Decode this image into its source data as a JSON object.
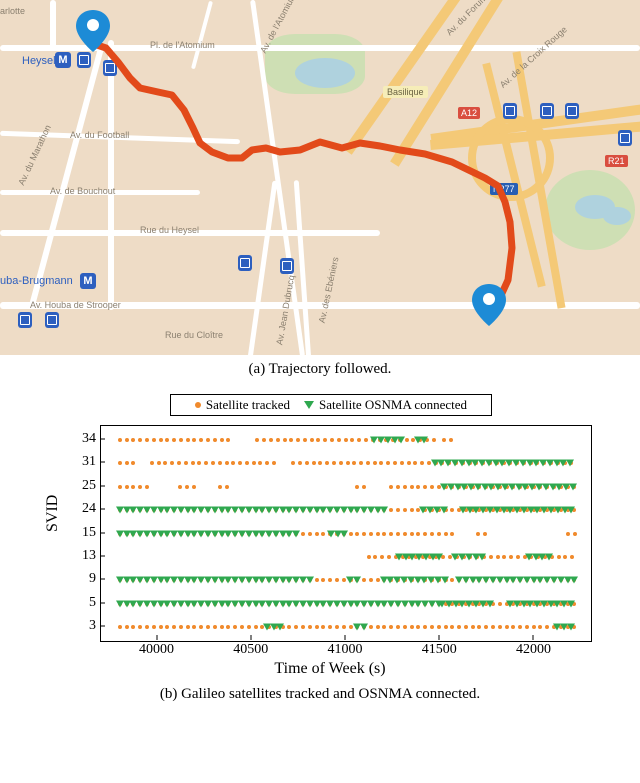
{
  "panel_a": {
    "caption": "(a) Trajectory followed.",
    "station_main": "Heysel",
    "station_secondary": "uba-Brugmann",
    "metro_letter": "M",
    "badge_basilique": "Basilique",
    "road_badge_a12": "A12",
    "road_badge_r21": "R21",
    "road_badge_n277_1": "N277",
    "road_badge_n277_2": "N277",
    "roads": {
      "arlotte": "arlotte",
      "atomium": "Pl. de l'Atomium",
      "av_atomium": "Av. de l'Atomium",
      "forum": "Av. du Forum",
      "croixrouge": "Av. de la Croix Rouge",
      "football": "Av. du Football",
      "bouchout": "Av. de Bouchout",
      "marathon": "Av. du Marathon",
      "heysel": "Rue du Heysel",
      "houba": "Av. Houba de Strooper",
      "cloitre": "Rue du Cloître",
      "eberiers": "Av. des Ebéniers",
      "jeandubrucq": "Av. Jean Dubrucq"
    }
  },
  "panel_b": {
    "caption": "(b) Galileo satellites tracked and OSNMA connected.",
    "legend_tracked": "Satellite tracked",
    "legend_osnma": "Satellite OSNMA connected",
    "ylabel": "SVID",
    "xlabel": "Time of Week (s)"
  },
  "chart_data": {
    "type": "scatter",
    "title": "",
    "xlabel": "Time of Week (s)",
    "ylabel": "SVID",
    "xlim": [
      39700,
      42300
    ],
    "y_ticks": [
      3,
      5,
      9,
      13,
      15,
      24,
      25,
      31,
      34
    ],
    "x_ticks": [
      40000,
      40500,
      41000,
      41500,
      42000
    ],
    "series": [
      {
        "name": "Satellite tracked",
        "marker": "circle",
        "color": "#f08a2c",
        "segments": [
          {
            "svid": 3,
            "ranges": [
              [
                39800,
                42220
              ]
            ]
          },
          {
            "svid": 5,
            "ranges": [
              [
                39800,
                42220
              ]
            ]
          },
          {
            "svid": 9,
            "ranges": [
              [
                39800,
                42220
              ]
            ]
          },
          {
            "svid": 13,
            "ranges": [
              [
                41120,
                42220
              ]
            ]
          },
          {
            "svid": 15,
            "ranges": [
              [
                39800,
                41580
              ],
              [
                41700,
                41750
              ],
              [
                42180,
                42220
              ]
            ]
          },
          {
            "svid": 24,
            "ranges": [
              [
                39800,
                42220
              ]
            ]
          },
          {
            "svid": 25,
            "ranges": [
              [
                39800,
                39950
              ],
              [
                40120,
                40200
              ],
              [
                40330,
                40380
              ],
              [
                41060,
                41100
              ],
              [
                41240,
                42220
              ]
            ]
          },
          {
            "svid": 31,
            "ranges": [
              [
                39800,
                39890
              ],
              [
                39970,
                40640
              ],
              [
                40720,
                42220
              ]
            ]
          },
          {
            "svid": 34,
            "ranges": [
              [
                39800,
                40410
              ],
              [
                40530,
                41040
              ],
              [
                41070,
                41480
              ],
              [
                41520,
                41570
              ]
            ]
          }
        ]
      },
      {
        "name": "Satellite OSNMA connected",
        "marker": "triangle_down",
        "color": "#2fa84f",
        "segments": [
          {
            "svid": 3,
            "ranges": [
              [
                40580,
                40680
              ],
              [
                41060,
                41130
              ],
              [
                42120,
                42220
              ]
            ]
          },
          {
            "svid": 5,
            "ranges": [
              [
                39800,
                41500
              ],
              [
                41510,
                41780
              ],
              [
                41870,
                42220
              ]
            ]
          },
          {
            "svid": 9,
            "ranges": [
              [
                39800,
                40830
              ],
              [
                41020,
                41090
              ],
              [
                41200,
                41540
              ],
              [
                41600,
                42220
              ]
            ]
          },
          {
            "svid": 13,
            "ranges": [
              [
                41280,
                41520
              ],
              [
                41580,
                41730
              ],
              [
                41970,
                42080
              ]
            ]
          },
          {
            "svid": 15,
            "ranges": [
              [
                39800,
                40750
              ],
              [
                40920,
                41000
              ]
            ]
          },
          {
            "svid": 24,
            "ranges": [
              [
                39800,
                41220
              ],
              [
                41410,
                41520
              ],
              [
                41620,
                42220
              ]
            ]
          },
          {
            "svid": 25,
            "ranges": [
              [
                41520,
                42220
              ]
            ]
          },
          {
            "svid": 31,
            "ranges": [
              [
                41470,
                42220
              ]
            ]
          },
          {
            "svid": 34,
            "ranges": [
              [
                41150,
                41320
              ],
              [
                41380,
                41450
              ]
            ]
          }
        ]
      }
    ]
  }
}
